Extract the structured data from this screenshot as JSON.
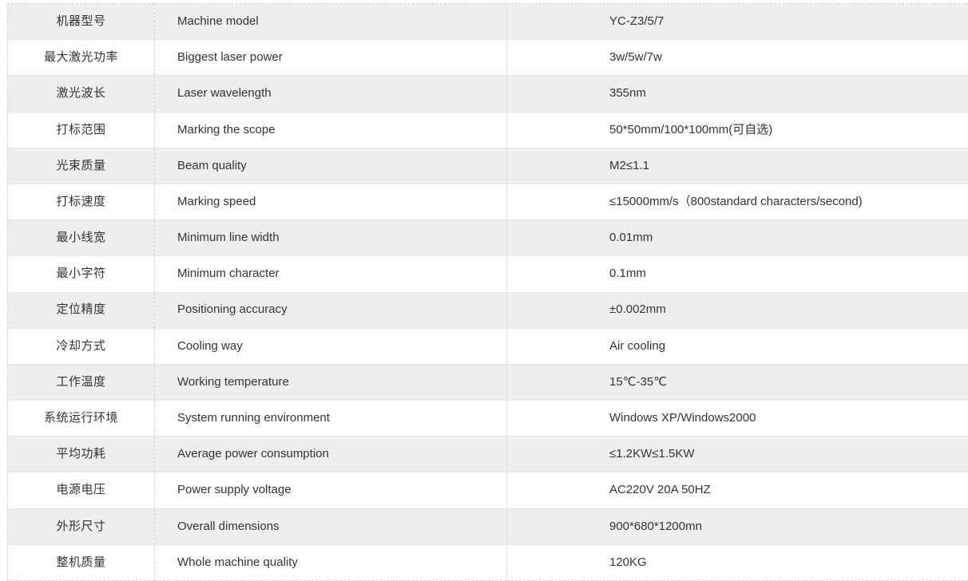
{
  "table": {
    "columns": [
      "chinese_label",
      "english_label",
      "value"
    ],
    "rows": [
      {
        "cn": "机器型号",
        "en": "Machine model",
        "val": "YC-Z3/5/7"
      },
      {
        "cn": "最大激光功率",
        "en": "Biggest laser power",
        "val": "3w/5w/7w"
      },
      {
        "cn": "激光波长",
        "en": "Laser wavelength",
        "val": "355nm"
      },
      {
        "cn": "打标范围",
        "en": "Marking the scope",
        "val": "50*50mm/100*100mm(可自选)"
      },
      {
        "cn": "光束质量",
        "en": "Beam quality",
        "val": "M2≤1.1"
      },
      {
        "cn": "打标速度",
        "en": "Marking speed",
        "val": "≤15000mm/s（800standard characters/second)"
      },
      {
        "cn": "最小线宽",
        "en": "Minimum line width",
        "val": "0.01mm"
      },
      {
        "cn": "最小字符",
        "en": "Minimum character",
        "val": "0.1mm"
      },
      {
        "cn": "定位精度",
        "en": "Positioning accuracy",
        "val": "±0.002mm"
      },
      {
        "cn": "冷却方式",
        "en": "Cooling way",
        "val": "Air cooling"
      },
      {
        "cn": "工作温度",
        "en": "Working temperature",
        "val": "15℃-35℃"
      },
      {
        "cn": "系统运行环境",
        "en": "System running environment",
        "val": "Windows XP/Windows2000"
      },
      {
        "cn": "平均功耗",
        "en": "Average power consumption",
        "val": "≤1.2KW≤1.5KW"
      },
      {
        "cn": "电源电压",
        "en": "Power supply voltage",
        "val": "AC220V 20A 50HZ"
      },
      {
        "cn": "外形尺寸",
        "en": "Overall dimensions",
        "val": "900*680*1200mn"
      },
      {
        "cn": "整机质量",
        "en": " Whole machine quality",
        "val": "120KG"
      }
    ]
  },
  "colors": {
    "row_shaded_bg": "#eeeeee",
    "row_plain_bg": "#ffffff",
    "text": "#333333",
    "border_dashed": "#cfcfcf",
    "border_solid": "#e6e6e6"
  }
}
